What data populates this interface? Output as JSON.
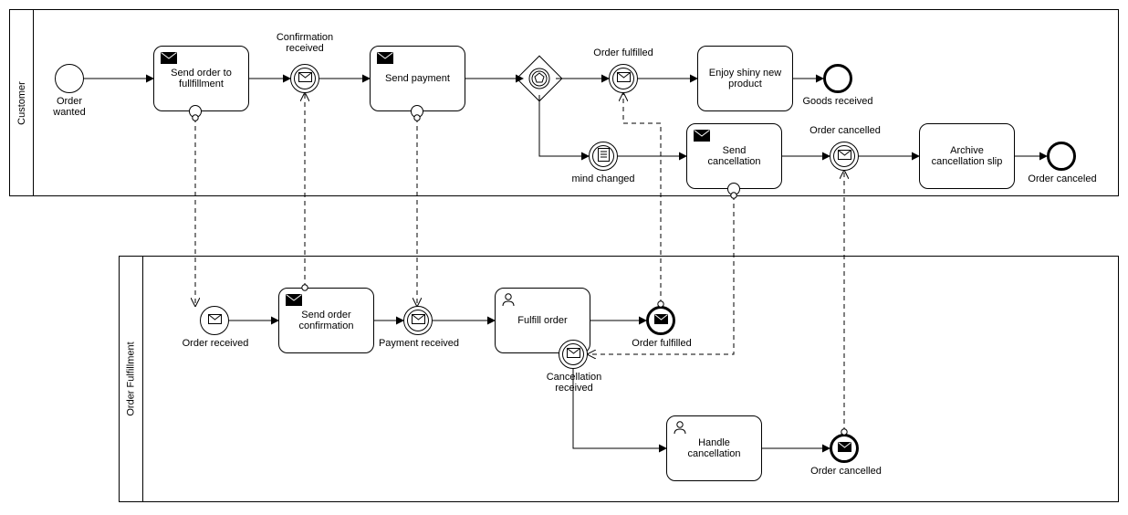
{
  "pools": {
    "customer": {
      "label": "Customer"
    },
    "fulfillment": {
      "label": "Order Fulfillment"
    }
  },
  "customer": {
    "start": {
      "label": "Order wanted"
    },
    "sendOrder": {
      "label": "Send order to\nfullfillment"
    },
    "confirmation": {
      "label": "Confirmation\nreceived"
    },
    "sendPayment": {
      "label": "Send payment"
    },
    "orderFulfilled": {
      "label": "Order fulfilled"
    },
    "enjoy": {
      "label": "Enjoy shiny new\nproduct"
    },
    "goodsReceived": {
      "label": "Goods received"
    },
    "mindChanged": {
      "label": "mind changed"
    },
    "sendCancellation": {
      "label": "Send\ncancellation"
    },
    "orderCancelled": {
      "label": "Order cancelled"
    },
    "archive": {
      "label": "Archive\ncancellation slip"
    },
    "orderCanceled": {
      "label": "Order canceled"
    }
  },
  "fulfillment": {
    "orderReceived": {
      "label": "Order received"
    },
    "sendConfirmation": {
      "label": "Send order\nconfirmation"
    },
    "paymentReceived": {
      "label": "Payment received"
    },
    "fulfillOrder": {
      "label": "Fulfill order"
    },
    "orderFulfilled": {
      "label": "Order fulfilled"
    },
    "cancellationReceived": {
      "label": "Cancellation\nreceived"
    },
    "handleCancellation": {
      "label": "Handle\ncancellation"
    },
    "orderCancelled": {
      "label": "Order cancelled"
    }
  }
}
